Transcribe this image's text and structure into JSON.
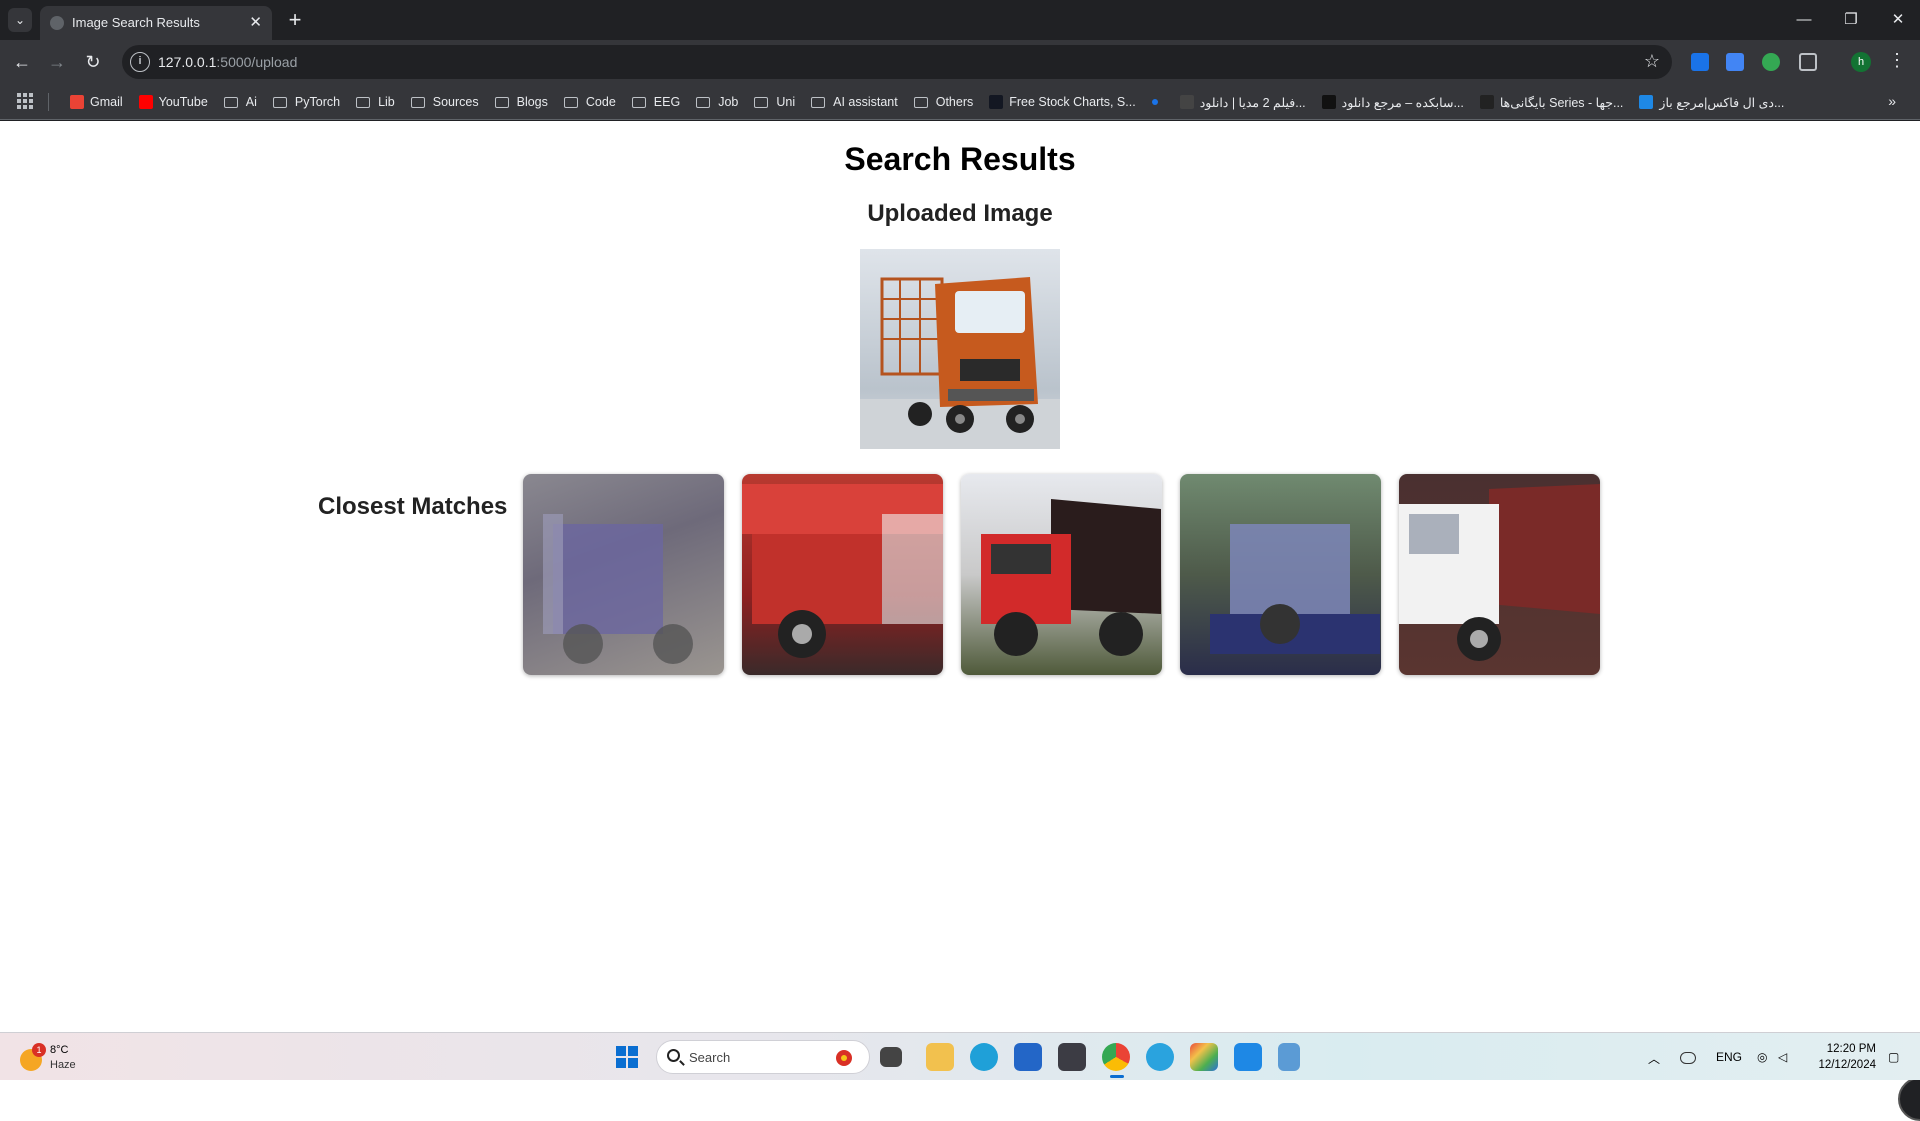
{
  "browser": {
    "tab_title": "Image Search Results",
    "url_host": "127.0.0.1",
    "url_rest": ":5000/upload",
    "profile_initial": "h"
  },
  "bookmarks": [
    {
      "label": "Gmail",
      "type": "gmail-icon"
    },
    {
      "label": "YouTube",
      "type": "youtube-icon"
    },
    {
      "label": "Ai",
      "type": "folder-icon"
    },
    {
      "label": "PyTorch",
      "type": "folder-icon"
    },
    {
      "label": "Lib",
      "type": "folder-icon"
    },
    {
      "label": "Sources",
      "type": "folder-icon"
    },
    {
      "label": "Blogs",
      "type": "folder-icon"
    },
    {
      "label": "Code",
      "type": "folder-icon"
    },
    {
      "label": "EEG",
      "type": "folder-icon"
    },
    {
      "label": "Job",
      "type": "folder-icon"
    },
    {
      "label": "Uni",
      "type": "folder-icon"
    },
    {
      "label": "AI assistant",
      "type": "folder-icon"
    },
    {
      "label": "Others",
      "type": "folder-icon"
    },
    {
      "label": "Free Stock Charts, S...",
      "type": "tradingview-icon"
    },
    {
      "label": "",
      "type": "dot-icon"
    },
    {
      "label": "فیلم 2 مدیا | دانلود...",
      "type": "site-icon"
    },
    {
      "label": "سابکده – مرجع دانلود...",
      "type": "subkade-icon"
    },
    {
      "label": "بایگانی‌ها Series - جها...",
      "type": "w-icon"
    },
    {
      "label": "دی ال فاکس|مرجع باز...",
      "type": "dlfox-icon"
    }
  ],
  "page": {
    "title": "Search Results",
    "uploaded_heading": "Uploaded Image",
    "matches_heading": "Closest Matches",
    "matches_count": 5
  },
  "taskbar": {
    "weather_temp": "8°C",
    "weather_desc": "Haze",
    "weather_badge": "1",
    "search_placeholder": "Search",
    "lang": "ENG",
    "time": "12:20 PM",
    "date": "12/12/2024"
  },
  "colors": {
    "chrome_dark": "#202124",
    "chrome_toolbar": "#35363a",
    "accent": "#0a6ed1"
  }
}
